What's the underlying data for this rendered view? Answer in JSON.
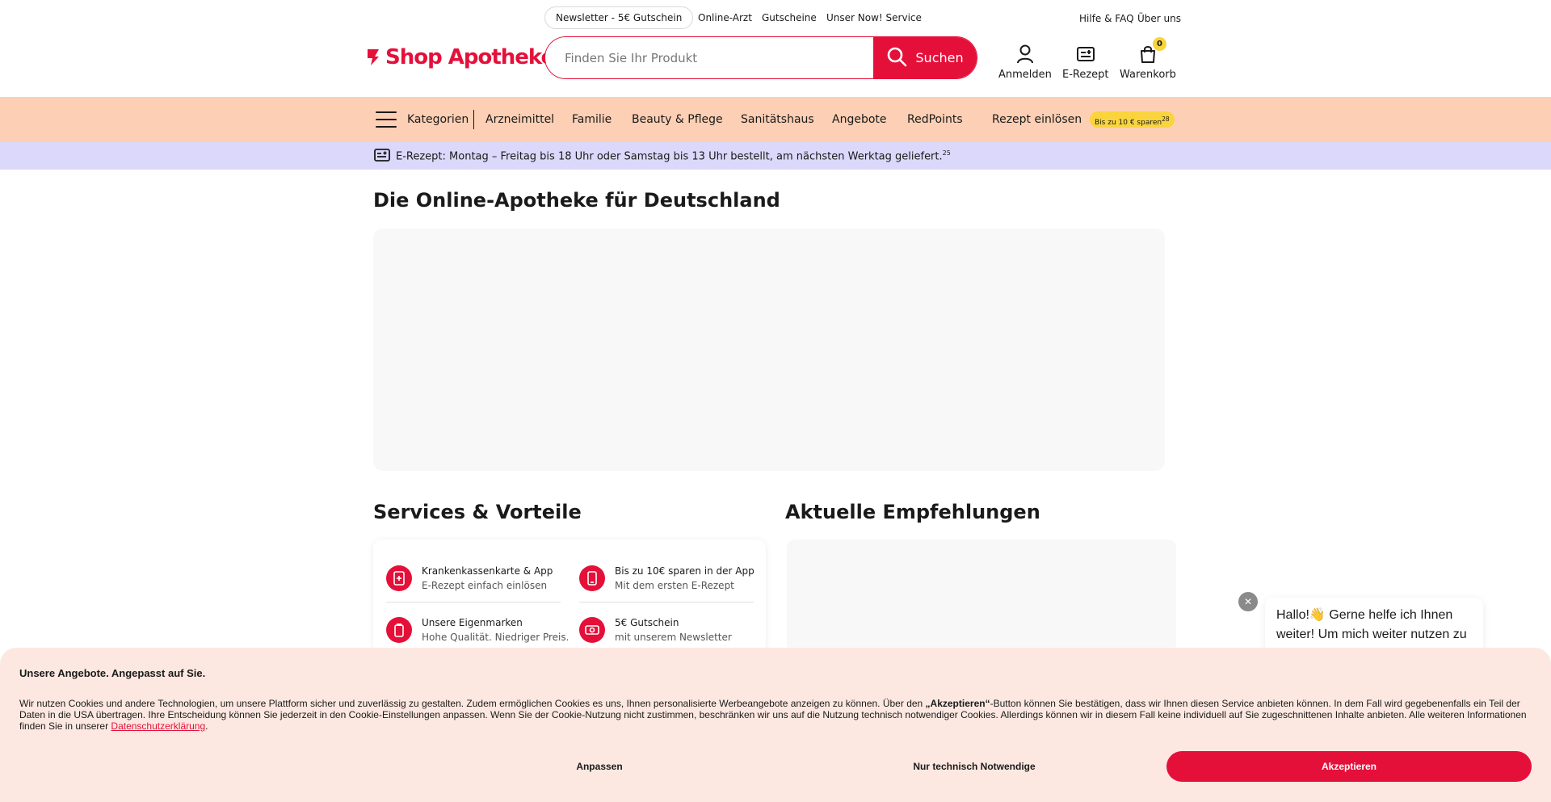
{
  "topbar": {
    "newsletter": "Newsletter - 5€ Gutschein",
    "online_arzt": "Online-Arzt",
    "gutscheine": "Gutscheine",
    "now_service": "Unser Now! Service",
    "hilfe": "Hilfe & FAQ",
    "ueber_uns": "Über uns"
  },
  "header": {
    "logo_text": "Shop Apotheke",
    "search_placeholder": "Finden Sie Ihr Produkt",
    "search_button": "Suchen",
    "login": "Anmelden",
    "erezept": "E-Rezept",
    "cart": "Warenkorb",
    "cart_count": "0"
  },
  "catnav": {
    "kategorien": "Kategorien",
    "items": [
      "Arzneimittel",
      "Familie",
      "Beauty & Pflege",
      "Sanitätshaus",
      "Angebote",
      "RedPoints"
    ],
    "rezept": "Rezept einlösen",
    "promo": "Bis zu 10 € sparen",
    "promo_sup": "28"
  },
  "infobar": {
    "text": "E-Rezept: Montag – Freitag bis 18 Uhr oder Samstag bis 13 Uhr bestellt, am nächsten Werktag geliefert.",
    "sup": "25"
  },
  "main": {
    "title": "Die Online-Apotheke für Deutschland",
    "services_title": "Services & Vorteile",
    "reco_title": "Aktuelle Empfehlungen",
    "services": [
      {
        "title": "Krankenkassenkarte & App",
        "subtitle": "E-Rezept einfach einlösen"
      },
      {
        "title": "Bis zu 10€ sparen in der App",
        "subtitle": "Mit dem ersten E-Rezept"
      },
      {
        "title": "Unsere Eigenmarken",
        "subtitle": "Hohe Qualität. Niedriger Preis."
      },
      {
        "title": "5€ Gutschein",
        "subtitle": "mit unserem Newsletter"
      }
    ]
  },
  "chat": {
    "close": "✕",
    "message": "Hallo!👋 Gerne helfe ich Ihnen weiter! Um mich weiter nutzen zu"
  },
  "cookie": {
    "title": "Unsere Angebote. Angepasst auf Sie.",
    "text_1": "Wir nutzen Cookies und andere Technologien, um unsere Plattform sicher und zuverlässig zu gestalten. Zudem ermöglichen Cookies es uns, Ihnen personalisierte Werbeangebote anzeigen zu können. Über den ",
    "text_bold": "„Akzeptieren“",
    "text_2": "-Button können Sie bestätigen, dass wir Ihnen diesen Service anbieten können. In dem Fall wird gegebenenfalls ein Teil der Daten in die USA übertragen. Ihre Entscheidung können Sie jederzeit in den Cookie-Einstellungen anpassen. Wenn Sie der Cookie-Nutzung nicht zustimmen, beschränken wir uns auf die Nutzung technisch notwendiger Cookies. Allerdings können wir in diesem Fall keine individuell auf Sie zugeschnittenen Inhalte anbieten. Alle weiteren Informationen finden Sie in unserer ",
    "link": "Datenschutzerklärung",
    "text_end": ".",
    "btn_customize": "Anpassen",
    "btn_necessary": "Nur technisch Notwendige",
    "btn_accept": "Akzeptieren"
  },
  "colors": {
    "brand_red": "#e5103a",
    "catnav_bg": "#fdcfb4",
    "infobar_bg": "#dcd8fb",
    "promo_yellow": "#f9d43d",
    "cookie_bg": "#fde8e1"
  }
}
